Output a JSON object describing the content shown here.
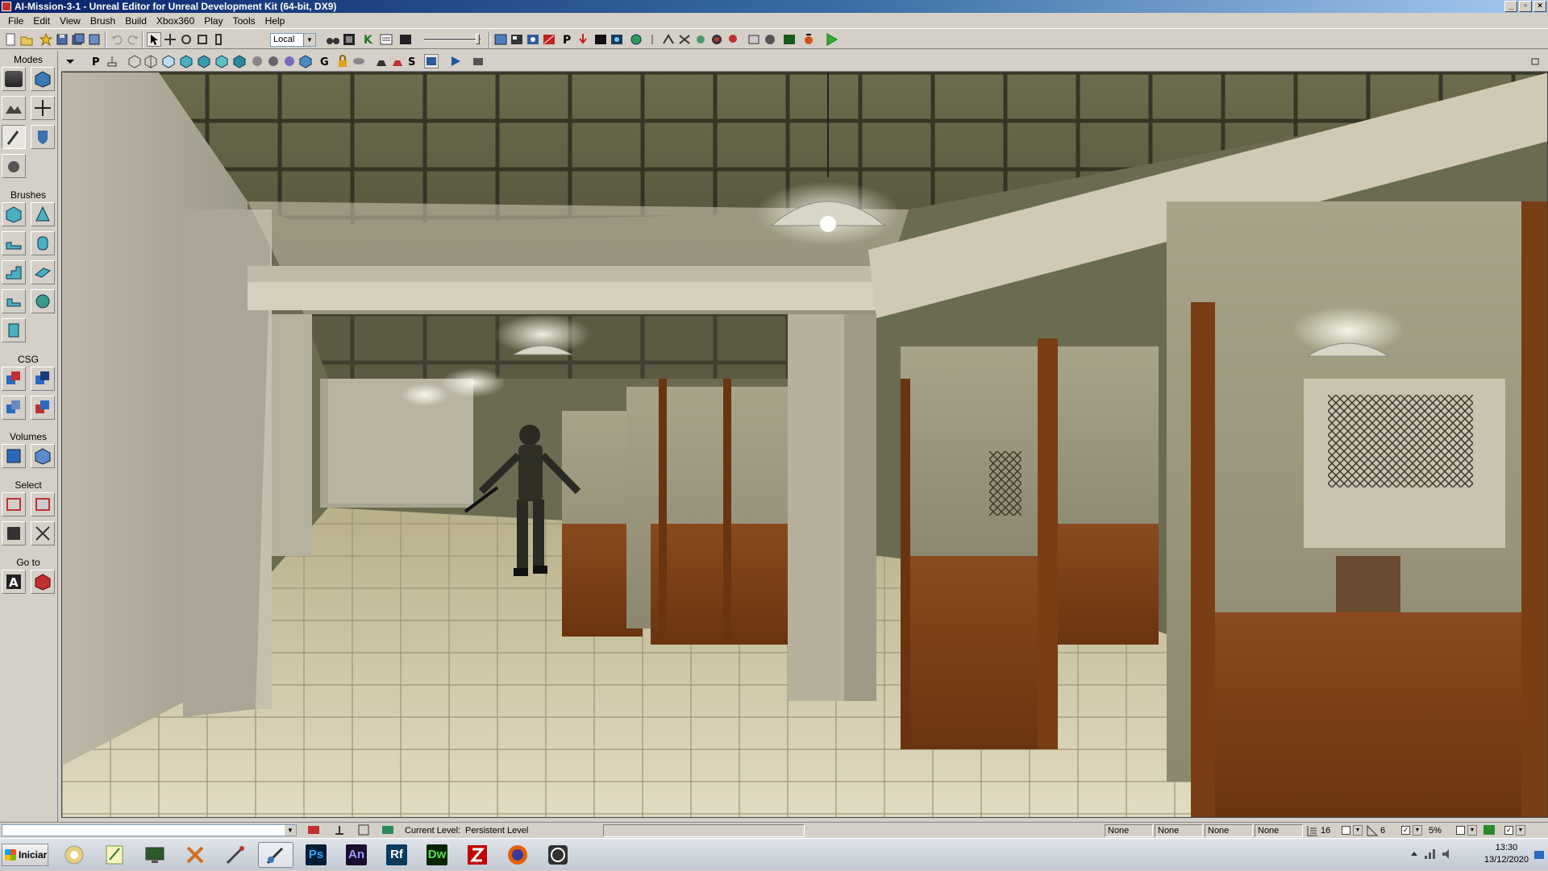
{
  "window": {
    "title": "AI-Mission-3-1 - Unreal Editor for Unreal Development Kit (64-bit, DX9)"
  },
  "menu": [
    {
      "label": "File"
    },
    {
      "label": "Edit"
    },
    {
      "label": "View"
    },
    {
      "label": "Brush"
    },
    {
      "label": "Build"
    },
    {
      "label": "Xbox360"
    },
    {
      "label": "Play"
    },
    {
      "label": "Tools"
    },
    {
      "label": "Help"
    }
  ],
  "toolbar": {
    "coordinate_system": "Local"
  },
  "left_panel": {
    "modes_label": "Modes",
    "brushes_label": "Brushes",
    "csg_label": "CSG",
    "volumes_label": "Volumes",
    "select_label": "Select",
    "goto_label": "Go to"
  },
  "viewport": {
    "toolbar_letters": {
      "p": "P",
      "g": "G",
      "s": "S"
    }
  },
  "status_bar": {
    "current_level_label": "Current Level:",
    "current_level_value": "Persistent Level",
    "fields": [
      "None",
      "None",
      "None",
      "None"
    ],
    "grid_size": "16",
    "rotation_snap": "6",
    "scale_snap": "5%"
  },
  "taskbar": {
    "start_label": "Iniciar",
    "apps": [
      {
        "name": "Photoshop",
        "abbr": "Ps",
        "color": "#001e36",
        "fg": "#31a8ff"
      },
      {
        "name": "Animate",
        "abbr": "An",
        "color": "#1a0d2e",
        "fg": "#9999ff"
      },
      {
        "name": "Reflector",
        "abbr": "Rf",
        "color": "#0b3c5d",
        "fg": "#ffffff"
      },
      {
        "name": "Dreamweaver",
        "abbr": "Dw",
        "color": "#072401",
        "fg": "#4fe04f"
      }
    ],
    "clock_time": "13:30",
    "clock_date": "13/12/2020"
  },
  "colors": {
    "title_bar": "#0a246a",
    "chrome": "#d4d0c8",
    "play_green": "#2db32d"
  }
}
